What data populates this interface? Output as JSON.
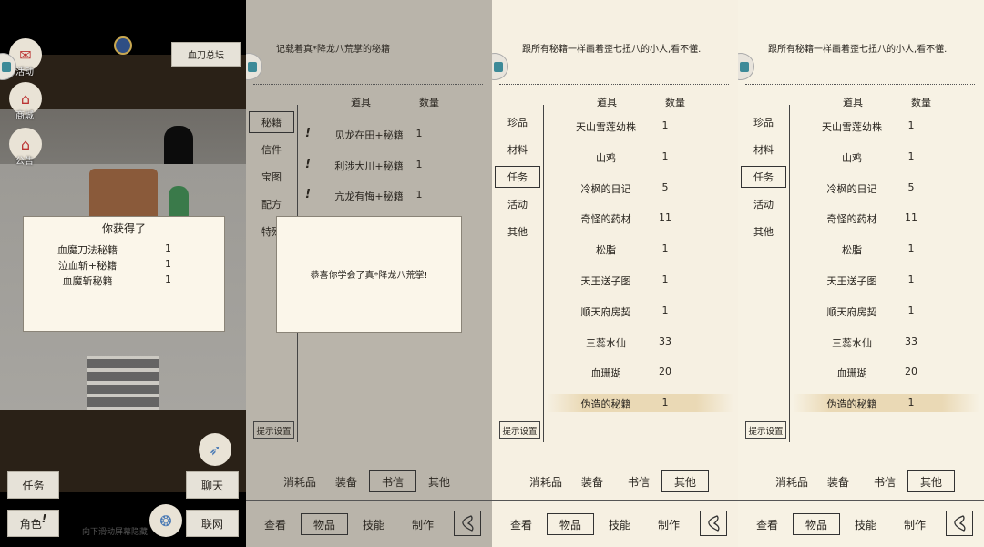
{
  "panel1": {
    "location_button": "血刀总坛",
    "side_icons": [
      {
        "label": "活动",
        "icon": "event-scroll-icon"
      },
      {
        "label": "商城",
        "icon": "shop-building-icon"
      },
      {
        "label": "公告",
        "icon": "notice-building-icon"
      }
    ],
    "reward_dialog": {
      "title": "你获得了",
      "items": [
        {
          "name": "血魔刀法秘籍",
          "qty": "1"
        },
        {
          "name": "泣血斩+秘籍",
          "qty": "1"
        },
        {
          "name": "血魔斩秘籍",
          "qty": "1"
        }
      ]
    },
    "buttons": {
      "quest": "任务",
      "chat": "聊天",
      "character": "角色",
      "network": "联网"
    },
    "character_badge": "!",
    "hint_text": "向下滑动屏幕隐藏"
  },
  "panel2": {
    "description": "记载着真*降龙八荒掌的秘籍",
    "headers": {
      "item": "道具",
      "qty": "数量"
    },
    "side_tabs": [
      "秘籍",
      "信件",
      "宝图",
      "配方",
      "特殊"
    ],
    "selected_side_tab": 0,
    "rows": [
      {
        "mark": "!",
        "name": "见龙在田+秘籍",
        "qty": "1"
      },
      {
        "mark": "!",
        "name": "利涉大川+秘籍",
        "qty": "1"
      },
      {
        "mark": "!",
        "name": "亢龙有悔+秘籍",
        "qty": "1"
      }
    ],
    "dialog_text": "恭喜你学会了真*降龙八荒掌!",
    "hint_settings": "提示设置",
    "sub_tabs": [
      "消耗品",
      "装备",
      "书信",
      "其他"
    ],
    "selected_sub_tab": 2,
    "main_tabs": [
      "查看",
      "物品",
      "技能",
      "制作"
    ],
    "selected_main_tab": 1
  },
  "panel3": {
    "description": "跟所有秘籍一样画着歪七扭八的小人,看不懂.",
    "headers": {
      "item": "道具",
      "qty": "数量"
    },
    "side_tabs": [
      "珍品",
      "材料",
      "任务",
      "活动",
      "其他"
    ],
    "selected_side_tab": 2,
    "rows": [
      {
        "name": "天山雪莲幼株",
        "qty": "1"
      },
      {
        "name": "山鸡",
        "qty": "1"
      },
      {
        "name": "冷枫的日记",
        "qty": "5"
      },
      {
        "name": "奇怪的药材",
        "qty": "11"
      },
      {
        "name": "松脂",
        "qty": "1"
      },
      {
        "name": "天王送子图",
        "qty": "1"
      },
      {
        "name": "顺天府房契",
        "qty": "1"
      },
      {
        "name": "三蕊水仙",
        "qty": "33"
      },
      {
        "name": "血珊瑚",
        "qty": "20"
      },
      {
        "name": "伪造的秘籍",
        "qty": "1"
      }
    ],
    "highlighted_row": 9,
    "hint_settings": "提示设置",
    "sub_tabs": [
      "消耗品",
      "装备",
      "书信",
      "其他"
    ],
    "selected_sub_tab": 3,
    "main_tabs": [
      "查看",
      "物品",
      "技能",
      "制作"
    ],
    "selected_main_tab": 1
  },
  "panel4": {
    "description": "跟所有秘籍一样画着歪七扭八的小人,看不懂.",
    "headers": {
      "item": "道具",
      "qty": "数量"
    },
    "side_tabs": [
      "珍品",
      "材料",
      "任务",
      "活动",
      "其他"
    ],
    "selected_side_tab": 2,
    "rows": [
      {
        "name": "天山雪莲幼株",
        "qty": "1"
      },
      {
        "name": "山鸡",
        "qty": "1"
      },
      {
        "name": "冷枫的日记",
        "qty": "5"
      },
      {
        "name": "奇怪的药材",
        "qty": "11"
      },
      {
        "name": "松脂",
        "qty": "1"
      },
      {
        "name": "天王送子图",
        "qty": "1"
      },
      {
        "name": "顺天府房契",
        "qty": "1"
      },
      {
        "name": "三蕊水仙",
        "qty": "33"
      },
      {
        "name": "血珊瑚",
        "qty": "20"
      },
      {
        "name": "伪造的秘籍",
        "qty": "1"
      }
    ],
    "highlighted_row": 9,
    "hint_settings": "提示设置",
    "sub_tabs": [
      "消耗品",
      "装备",
      "书信",
      "其他"
    ],
    "selected_sub_tab": 3,
    "main_tabs": [
      "查看",
      "物品",
      "技能",
      "制作"
    ],
    "selected_main_tab": 1
  }
}
